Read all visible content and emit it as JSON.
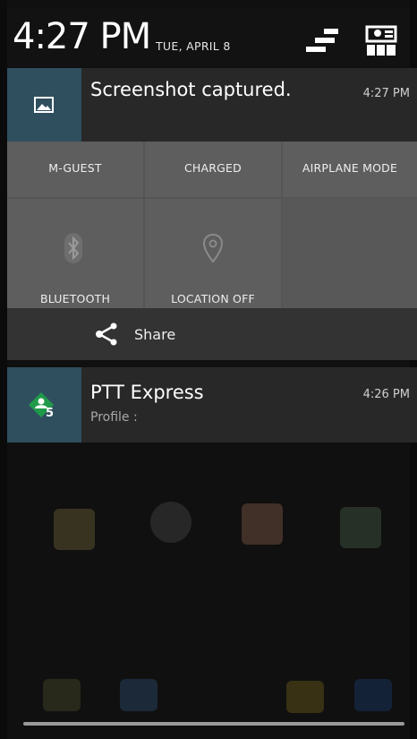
{
  "status_bar": {
    "time": "4:27 PM",
    "date": "TUE, APRIL 8",
    "icons": [
      "quick-settings-toggle-icon",
      "settings-grid-icon"
    ]
  },
  "screenshot_notification": {
    "icon": "image-icon",
    "title": "Screenshot captured.",
    "time": "4:27 PM",
    "accent_color": "#2f4f5f"
  },
  "quick_settings": {
    "row1": [
      "M-GUEST",
      "CHARGED",
      "AIRPLANE MODE"
    ],
    "bluetooth_label": "BLUETOOTH",
    "location_label": "LOCATION OFF",
    "icons": [
      "bluetooth-icon",
      "location-icon"
    ]
  },
  "share_action": {
    "icon": "share-icon",
    "label": "Share"
  },
  "ptt_notification": {
    "icon": "ptt-express-icon",
    "badge": "5",
    "title": "PTT Express",
    "time": "4:26 PM",
    "subtitle": "Profile :",
    "accent_color": "#1f9a4a"
  }
}
